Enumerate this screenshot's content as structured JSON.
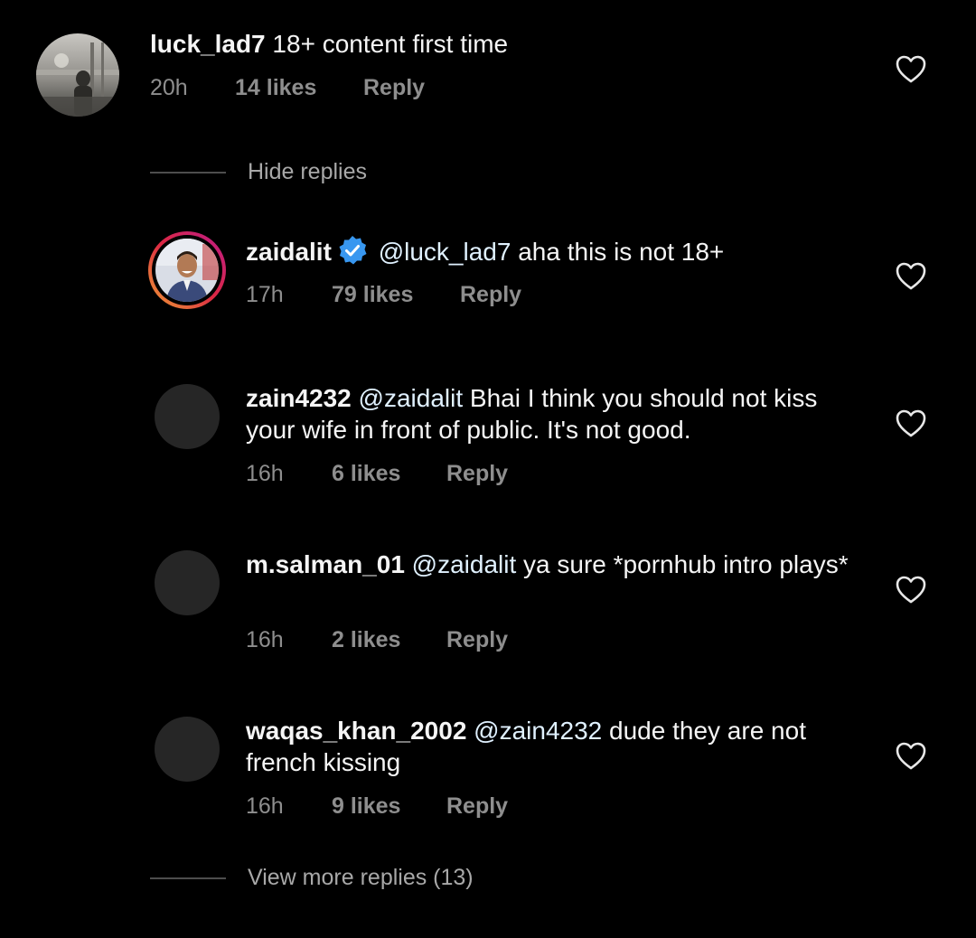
{
  "comments": [
    {
      "username": "luck_lad7",
      "text": "18+ content first time",
      "mention": "",
      "time": "20h",
      "likes": "14 likes",
      "reply": "Reply",
      "verified": false
    }
  ],
  "hide_replies": "Hide replies",
  "replies": [
    {
      "username": "zaidalit",
      "mention": "@luck_lad7",
      "text": "aha this is not 18+",
      "time": "17h",
      "likes": "79 likes",
      "reply": "Reply",
      "verified": true
    },
    {
      "username": "zain4232",
      "mention": "@zaidalit",
      "text": "Bhai I think you should not kiss your wife in front of public. It's not good.",
      "time": "16h",
      "likes": "6 likes",
      "reply": "Reply",
      "verified": false
    },
    {
      "username": "m.salman_01",
      "mention": "@zaidalit",
      "text": "ya sure *pornhub intro plays*",
      "time": "16h",
      "likes": "2 likes",
      "reply": "Reply",
      "verified": false
    },
    {
      "username": "waqas_khan_2002",
      "mention": "@zain4232",
      "text": "dude they are not french kissing",
      "time": "16h",
      "likes": "9 likes",
      "reply": "Reply",
      "verified": false
    }
  ],
  "view_more_replies": "View more replies (13)",
  "colors": {
    "background": "#000000",
    "text": "#f5f5f5",
    "meta": "#8e8e8e",
    "verified_badge": "#3897f0",
    "story_ring_start": "#f09433",
    "story_ring_end": "#bc1888"
  },
  "icons": [
    "heart-icon",
    "verified-badge-icon"
  ]
}
